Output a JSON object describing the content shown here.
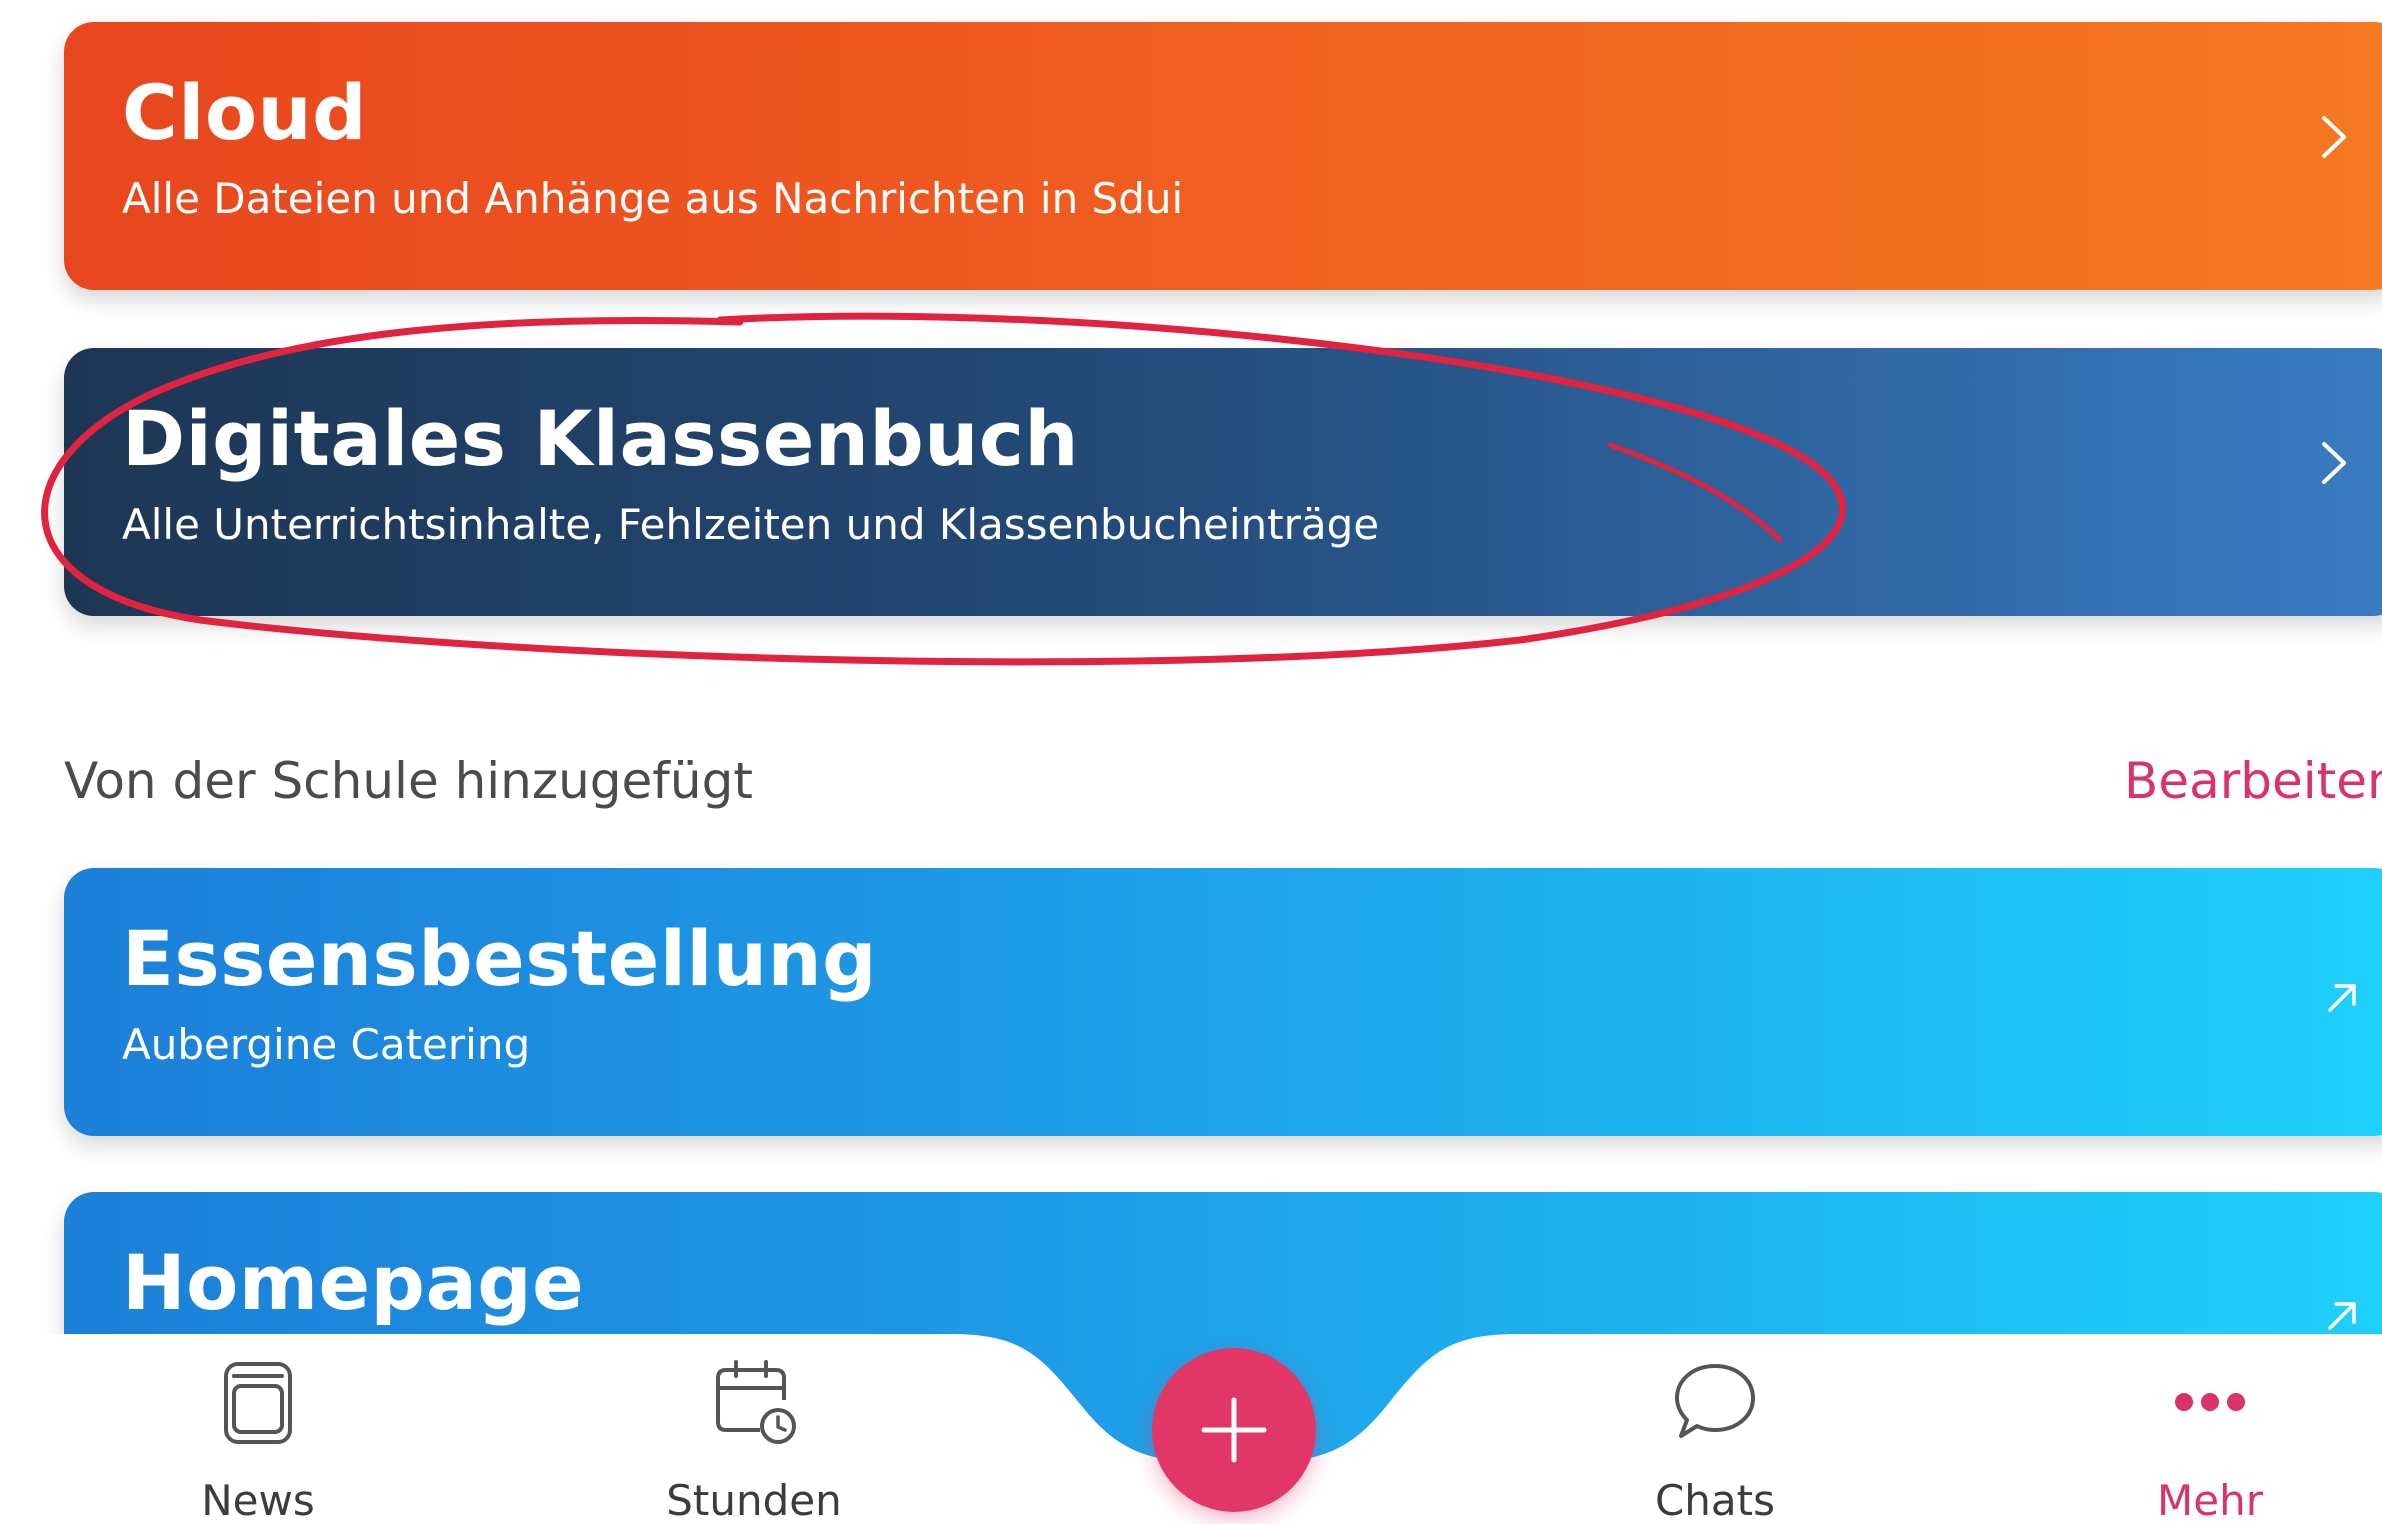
{
  "cards": [
    {
      "title": "Cloud",
      "subtitle": "Alle Dateien und Anhänge aus Nachrichten in Sdui",
      "icon": "chevron-right-icon"
    },
    {
      "title": "Digitales Klassenbuch",
      "subtitle": "Alle Unterrichtsinhalte, Fehlzeiten und Klassenbucheinträge",
      "icon": "chevron-right-icon"
    }
  ],
  "section": {
    "label": "Von der Schule hinzugefügt",
    "action": "Bearbeiten"
  },
  "school_cards": [
    {
      "title": "Essensbestellung",
      "subtitle": "Aubergine Catering",
      "icon": "external-link-icon"
    },
    {
      "title": "Homepage",
      "icon": "external-link-icon"
    }
  ],
  "bottom_nav": {
    "items": [
      {
        "label": "News",
        "icon": "news-icon"
      },
      {
        "label": "Stunden",
        "icon": "calendar-clock-icon"
      },
      {
        "label": "Chats",
        "icon": "chat-bubble-icon"
      },
      {
        "label": "Mehr",
        "icon": "more-dots-icon",
        "active": true
      }
    ],
    "fab_icon": "plus-icon"
  },
  "colors": {
    "accent": "#e23666",
    "cloud_card": "#ef5a20",
    "klassenbuch_card": "#234a78",
    "school_card": "#1e9ee8",
    "annotation": "#e2233f"
  }
}
